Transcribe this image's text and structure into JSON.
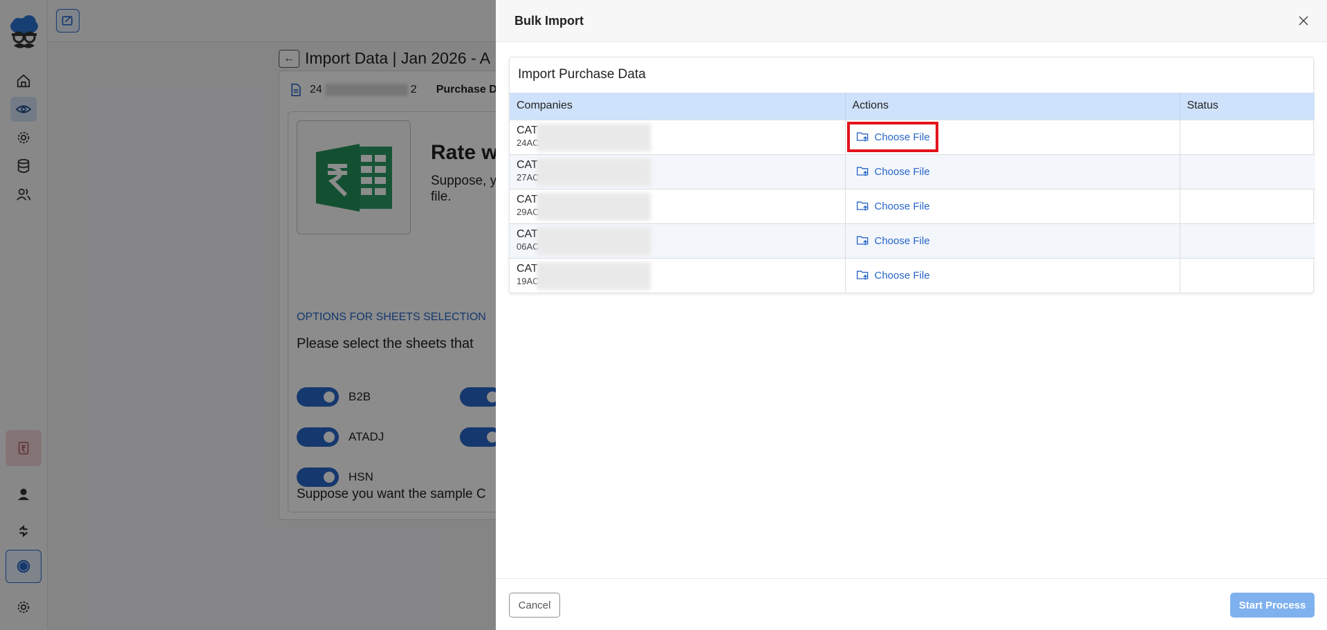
{
  "background": {
    "page_title": "Import Data | Jan 2026 - A",
    "gstin_prefix": "24",
    "gstin_suffix": "2",
    "section_label": "Purchase D",
    "card_title": "Rate w",
    "card_text": "Suppose, y file.",
    "options_title": "OPTIONS FOR SHEETS SELECTION",
    "options_subtitle": "Please select the sheets that",
    "toggles": [
      {
        "label": "B2B",
        "on": true
      },
      {
        "label": "ATADJ",
        "on": true
      },
      {
        "label": "HSN",
        "on": true
      }
    ],
    "sample_text": "Suppose you want the sample C"
  },
  "drawer": {
    "title": "Bulk Import",
    "close_icon": "close-icon",
    "panel_title": "Import Purchase Data",
    "columns": [
      "Companies",
      "Actions",
      "Status"
    ],
    "rows": [
      {
        "company": "CAT",
        "gstin": "24AC",
        "action": "Choose File",
        "status": ""
      },
      {
        "company": "CAT",
        "gstin": "27AC",
        "action": "Choose File",
        "status": ""
      },
      {
        "company": "CAT",
        "gstin": "29AC",
        "action": "Choose File",
        "status": ""
      },
      {
        "company": "CAT",
        "gstin": "06AC",
        "action": "Choose File",
        "status": ""
      },
      {
        "company": "CAT",
        "gstin": "19AC",
        "action": "Choose File",
        "status": ""
      }
    ],
    "cancel_label": "Cancel",
    "start_label": "Start Process"
  },
  "colors": {
    "accent": "#2766c8",
    "header_row": "#cfe2fb",
    "highlight": "#e3131b",
    "start_button": "#7fb1ef"
  }
}
